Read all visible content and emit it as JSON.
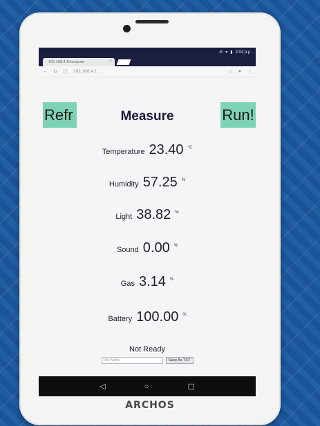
{
  "status_bar": {
    "time": "2:04 p.μ."
  },
  "browser": {
    "tab_title": "192.168.4.1/measure",
    "url": "192.168.4.1"
  },
  "page": {
    "refresh_label": "Refr",
    "run_label": "Run!",
    "title": "Measure",
    "readings": [
      {
        "label": "Temperature",
        "value": "23.40",
        "unit": "°C"
      },
      {
        "label": "Humidity",
        "value": "57.25",
        "unit": "%"
      },
      {
        "label": "Light",
        "value": "38.82",
        "unit": "%"
      },
      {
        "label": "Sound",
        "value": "0.00",
        "unit": "%"
      },
      {
        "label": "Gas",
        "value": "3.14",
        "unit": "%"
      },
      {
        "label": "Battery",
        "value": "100.00",
        "unit": "%"
      }
    ],
    "status": "Not Ready",
    "file_name_placeholder": "File Name",
    "file_name_value": "",
    "save_label": "Save As TXT"
  },
  "device": {
    "brand": "ARCHOS"
  },
  "icons": {
    "back": "back-icon",
    "home": "home-icon",
    "recents": "recents-icon",
    "refresh": "refresh-icon",
    "star": "star-icon",
    "mic": "mic-icon",
    "menu": "menu-icon"
  },
  "colors": {
    "button_green": "#7ed3b4",
    "status_bar": "#1b1e3f",
    "page_bg": "#f5f5f8",
    "bedspread": "#5896c8",
    "tablet_body": "#f4f4f2"
  }
}
